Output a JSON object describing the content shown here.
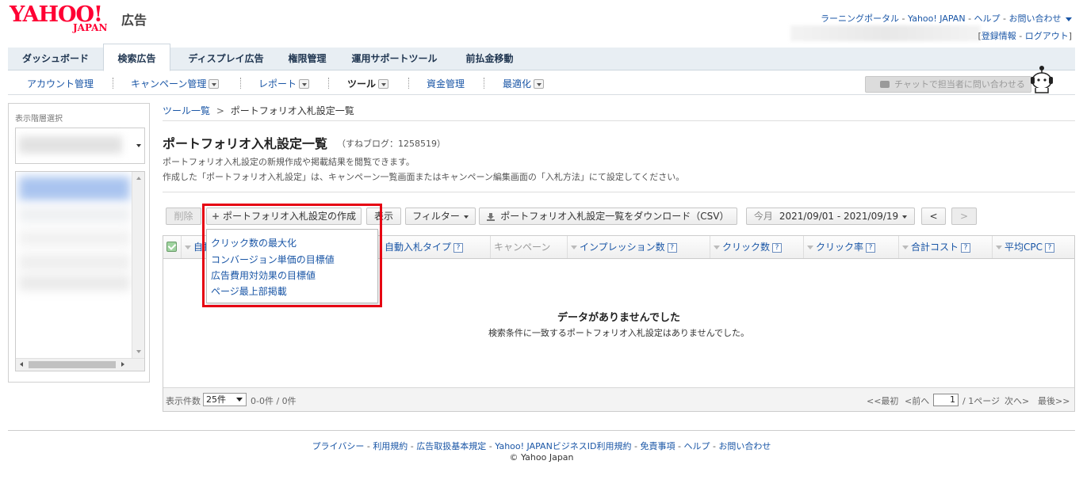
{
  "header": {
    "logo_text": "YAHOO!",
    "logo_sub": "JAPAN",
    "logo_ad": "広告",
    "top_links": [
      "ラーニングポータル",
      "Yahoo! JAPAN",
      "ヘルプ",
      "お問い合わせ"
    ],
    "account_links": [
      "登録情報",
      "ログアウト"
    ]
  },
  "tabs": [
    {
      "label": "ダッシュボード",
      "active": false
    },
    {
      "label": "検索広告",
      "active": true
    },
    {
      "label": "ディスプレイ広告",
      "active": false
    },
    {
      "label": "権限管理",
      "active": false
    },
    {
      "label": "運用サポートツール",
      "active": false
    },
    {
      "label": "前払金移動",
      "active": false
    }
  ],
  "subnav": [
    {
      "label": "アカウント管理",
      "dropdown": false
    },
    {
      "label": "キャンペーン管理",
      "dropdown": true
    },
    {
      "label": "レポート",
      "dropdown": true
    },
    {
      "label": "ツール",
      "dropdown": true,
      "active": true
    },
    {
      "label": "資金管理",
      "dropdown": false
    },
    {
      "label": "最適化",
      "dropdown": true
    }
  ],
  "chat_button": "チャットで担当者に問い合わせる",
  "left_panel": {
    "title": "表示階層選択"
  },
  "breadcrumb": {
    "root": "ツール一覧",
    "sep": ">",
    "current": "ポートフォリオ入札設定一覧"
  },
  "page": {
    "title": "ポートフォリオ入札設定一覧",
    "subtitle": "（すねブログ：1258519）",
    "desc1": "ポートフォリオ入札設定の新規作成や掲載結果を閲覧できます。",
    "desc2": "作成した「ポートフォリオ入札設定」は、キャンペーン一覧画面またはキャンペーン編集画面の「入札方法」にて設定してください。"
  },
  "toolbar": {
    "delete": "削除",
    "create": "ポートフォリオ入札設定の作成",
    "show": "表示",
    "filter": "フィルター",
    "download": "ポートフォリオ入札設定一覧をダウンロード（CSV）",
    "period_label": "今月",
    "period": "2021/09/01 - 2021/09/19",
    "prev": "<",
    "next": ">"
  },
  "menu_items": [
    "クリック数の最大化",
    "コンバージョン単価の目標値",
    "広告費用対効果の目標値",
    "ページ最上部掲載"
  ],
  "grid": {
    "columns": [
      "自動入札",
      "自動入札タイプ",
      "キャンペーン",
      "インプレッション数",
      "クリック数",
      "クリック率",
      "合計コスト",
      "平均CPC"
    ],
    "empty_title": "データがありませんでした",
    "empty_sub": "検索条件に一致するポートフォリオ入札設定はありませんでした。",
    "help_mark": "?"
  },
  "pager": {
    "per_page_label": "表示件数",
    "per_page": "25件",
    "count": "0-0件 / 0件",
    "first": "<<最初",
    "prev": "<前へ",
    "page": "1",
    "total": "/ 1ページ",
    "next": "次へ>",
    "last": "最後>>"
  },
  "footer": {
    "links": [
      "プライバシー",
      "利用規約",
      "広告取扱基本規定",
      "Yahoo! JAPANビジネスID利用規約",
      "免責事項",
      "ヘルプ",
      "お問い合わせ"
    ],
    "copyright": "© Yahoo Japan"
  },
  "colors": {
    "brand": "#ff0033",
    "link": "#1a56a6",
    "highlight": "#e60012"
  }
}
